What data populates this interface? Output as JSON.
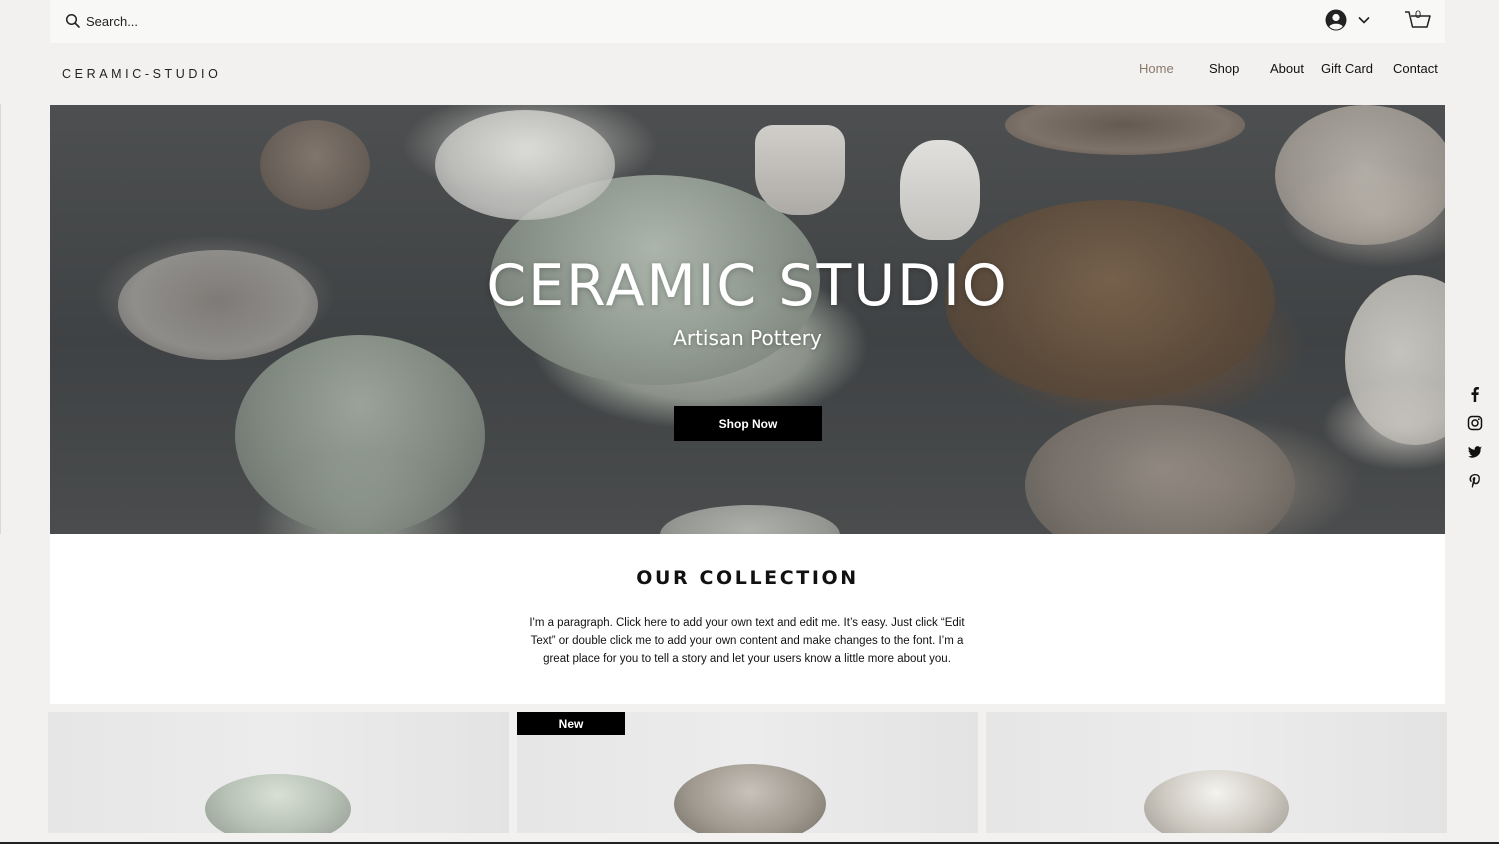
{
  "search": {
    "placeholder": "Search..."
  },
  "cart": {
    "count": "0"
  },
  "header": {
    "brand": "CERAMIC-STUDIO"
  },
  "nav": {
    "items": [
      {
        "label": "Home",
        "active": true
      },
      {
        "label": "Shop"
      },
      {
        "label": "About"
      },
      {
        "label": "Gift Card"
      },
      {
        "label": "Contact"
      }
    ],
    "active_color": "#8a7a6a"
  },
  "hero": {
    "title": "CERAMIC STUDIO",
    "subtitle": "Artisan Pottery",
    "cta_label": "Shop Now"
  },
  "collection": {
    "title": "OUR COLLECTION",
    "paragraph": "I'm a paragraph. Click here to add your own text and edit me. It’s easy. Just click “Edit Text” or double click me to add your own content and make changes to the font. I’m a great place for you to tell a story and let your users know a little more about you."
  },
  "products": [
    {
      "badge": ""
    },
    {
      "badge": "New"
    },
    {
      "badge": ""
    }
  ],
  "social": [
    "facebook-icon",
    "instagram-icon",
    "twitter-icon",
    "pinterest-icon"
  ]
}
